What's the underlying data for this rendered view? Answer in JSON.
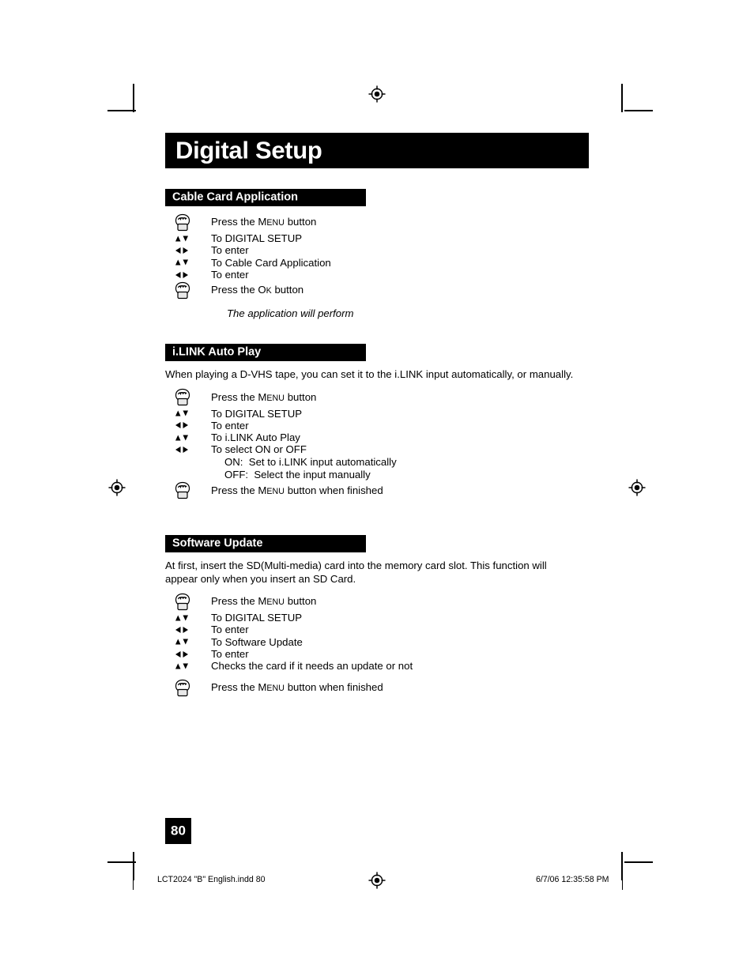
{
  "document": {
    "title": "Digital Setup",
    "page_number": "80"
  },
  "icons": {
    "hand_press": "hand-press-icon",
    "updown": "up-down-arrows-icon",
    "leftright": "left-right-arrows-icon",
    "registration": "registration-target-mark"
  },
  "sections": [
    {
      "header": "Cable Card Application",
      "intro": "",
      "steps": [
        {
          "icon": "hand_press",
          "label_lead": "Press the ",
          "label_cap_first": "M",
          "label_cap_rest": "ENU",
          "label_tail": " button"
        },
        {
          "icon": "updown",
          "label": "To DIGITAL SETUP"
        },
        {
          "icon": "leftright",
          "label": "To enter"
        },
        {
          "icon": "updown",
          "label": "To Cable Card Application"
        },
        {
          "icon": "leftright",
          "label": "To enter"
        },
        {
          "icon": "hand_press",
          "label_lead": "Press the ",
          "label_cap_first": "O",
          "label_cap_rest": "K",
          "label_tail": " button"
        }
      ],
      "note": "The application will perform",
      "sublines": []
    },
    {
      "header": "i.LINK Auto Play",
      "intro": "When playing a D-VHS tape, you can set it to the i.LINK input automatically, or manually.",
      "steps": [
        {
          "icon": "hand_press",
          "label_lead": "Press the ",
          "label_cap_first": "M",
          "label_cap_rest": "ENU",
          "label_tail": " button"
        },
        {
          "icon": "updown",
          "label": "To DIGITAL SETUP"
        },
        {
          "icon": "leftright",
          "label": "To enter"
        },
        {
          "icon": "updown",
          "label": "To i.LINK Auto Play"
        },
        {
          "icon": "leftright",
          "label": "To select ON or OFF"
        }
      ],
      "sublines": [
        "ON:  Set to i.LINK input automatically",
        "OFF:  Select the input manually"
      ],
      "final_step": {
        "icon": "hand_press",
        "label_lead": "Press the ",
        "label_cap_first": "M",
        "label_cap_rest": "ENU",
        "label_tail": " button when finished"
      },
      "note": ""
    },
    {
      "header": "Software Update",
      "intro": "At first, insert the SD(Multi-media) card into the memory card slot.  This function will appear only when you insert an SD Card.",
      "steps": [
        {
          "icon": "hand_press",
          "label_lead": "Press the ",
          "label_cap_first": "M",
          "label_cap_rest": "ENU",
          "label_tail": " button"
        },
        {
          "icon": "updown",
          "label": "To DIGITAL SETUP"
        },
        {
          "icon": "leftright",
          "label": "To enter"
        },
        {
          "icon": "updown",
          "label": "To Software Update"
        },
        {
          "icon": "leftright",
          "label": "To enter"
        },
        {
          "icon": "updown",
          "label": "Checks the card if it needs an update or not"
        }
      ],
      "sublines": [],
      "final_step": {
        "icon": "hand_press",
        "label_lead": "Press the ",
        "label_cap_first": "M",
        "label_cap_rest": "ENU",
        "label_tail": " button when finished"
      },
      "note": ""
    }
  ],
  "footer": {
    "left": "LCT2024 \"B\" English.indd   80",
    "right": "6/7/06   12:35:58 PM"
  },
  "colors": {
    "bar": "#000000",
    "text": "#000000",
    "background": "#ffffff"
  }
}
